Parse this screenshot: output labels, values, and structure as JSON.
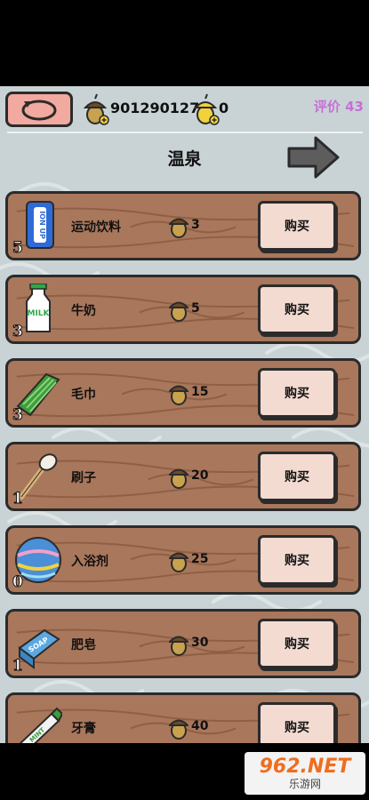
{
  "hud": {
    "coins": "901290127",
    "gold_acorns": "0",
    "rating": "评价 43"
  },
  "page": {
    "title": "温泉"
  },
  "items": [
    {
      "name": "运动饮料",
      "count": "5",
      "price": "3",
      "buy_label": "购买",
      "icon": "ion-drink-icon"
    },
    {
      "name": "牛奶",
      "count": "3",
      "price": "5",
      "buy_label": "购买",
      "icon": "milk-icon"
    },
    {
      "name": "毛巾",
      "count": "3",
      "price": "15",
      "buy_label": "购买",
      "icon": "towel-icon"
    },
    {
      "name": "刷子",
      "count": "1",
      "price": "20",
      "buy_label": "购买",
      "icon": "brush-icon"
    },
    {
      "name": "入浴剂",
      "count": "0",
      "price": "25",
      "buy_label": "购买",
      "icon": "bath-ball-icon"
    },
    {
      "name": "肥皂",
      "count": "1",
      "price": "30",
      "buy_label": "购买",
      "icon": "soap-icon"
    },
    {
      "name": "牙膏",
      "count": "",
      "price": "40",
      "buy_label": "购买",
      "icon": "toothpaste-icon"
    }
  ],
  "labels": {
    "ion_text": "ION UP",
    "milk_text": "MILK",
    "soap_text": "SOAP",
    "mint_text": "MINT"
  },
  "watermark": {
    "main": "962.NET",
    "sub": "乐游网"
  },
  "colors": {
    "plank": "#a9775b",
    "buy_button": "#f3dbd1",
    "back_button": "#f2a99f",
    "rating": "#c86fd6",
    "background": "#c9d3d6"
  }
}
